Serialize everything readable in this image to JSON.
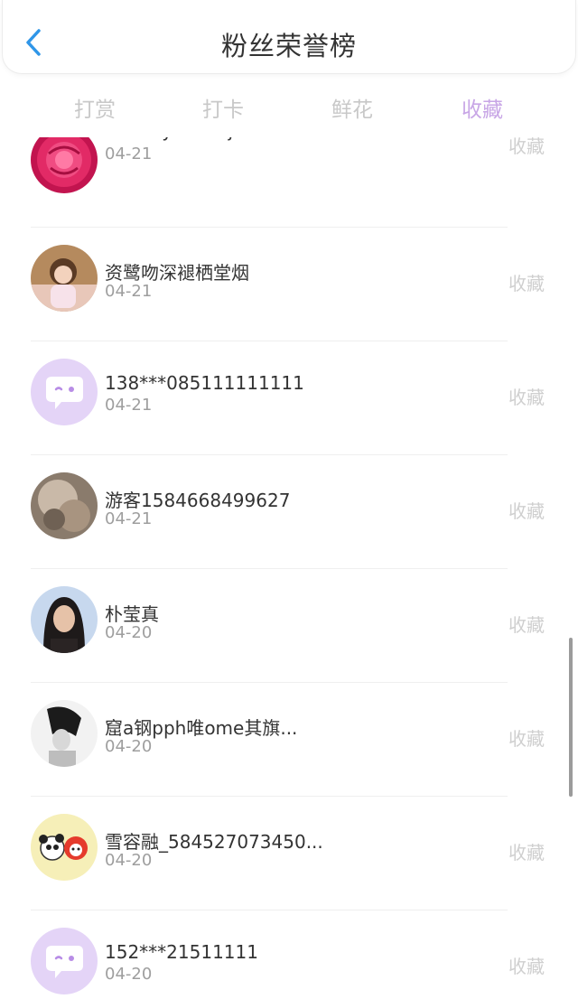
{
  "header": {
    "title": "粉丝荣誉榜",
    "back_icon": "chevron-left-icon",
    "accent_color": "#2f96e8"
  },
  "tabs": [
    {
      "label": "打赏",
      "active": false
    },
    {
      "label": "打卡",
      "active": false
    },
    {
      "label": "鲜花",
      "active": false
    },
    {
      "label": "收藏",
      "active": true
    }
  ],
  "colors": {
    "active_tab": "#c8a6e6",
    "default_avatar": "#e4d4f7"
  },
  "list": [
    {
      "name": "marcbymarccjacobs",
      "date": "04-21",
      "action": "收藏",
      "avatar": "rose-photo-avatar"
    },
    {
      "name": "资鹭吻深褪栖堂烟",
      "date": "04-21",
      "action": "收藏",
      "avatar": "child-photo-avatar"
    },
    {
      "name": "138***085111111111",
      "date": "04-21",
      "action": "收藏",
      "avatar": "default-chat-avatar"
    },
    {
      "name": "游客1584668499627",
      "date": "04-21",
      "action": "收藏",
      "avatar": "blurred-photo-avatar"
    },
    {
      "name": "朴莹真",
      "date": "04-20",
      "action": "收藏",
      "avatar": "woman-photo-avatar"
    },
    {
      "name": "窟a钢pph唯ome其旗...",
      "date": "04-20",
      "action": "收藏",
      "avatar": "bw-photo-avatar"
    },
    {
      "name": "雪容融_584527073450...",
      "date": "04-20",
      "action": "收藏",
      "avatar": "panda-mascot-avatar"
    },
    {
      "name": "152***21511111",
      "date": "04-20",
      "action": "收藏",
      "avatar": "default-chat-avatar"
    }
  ]
}
